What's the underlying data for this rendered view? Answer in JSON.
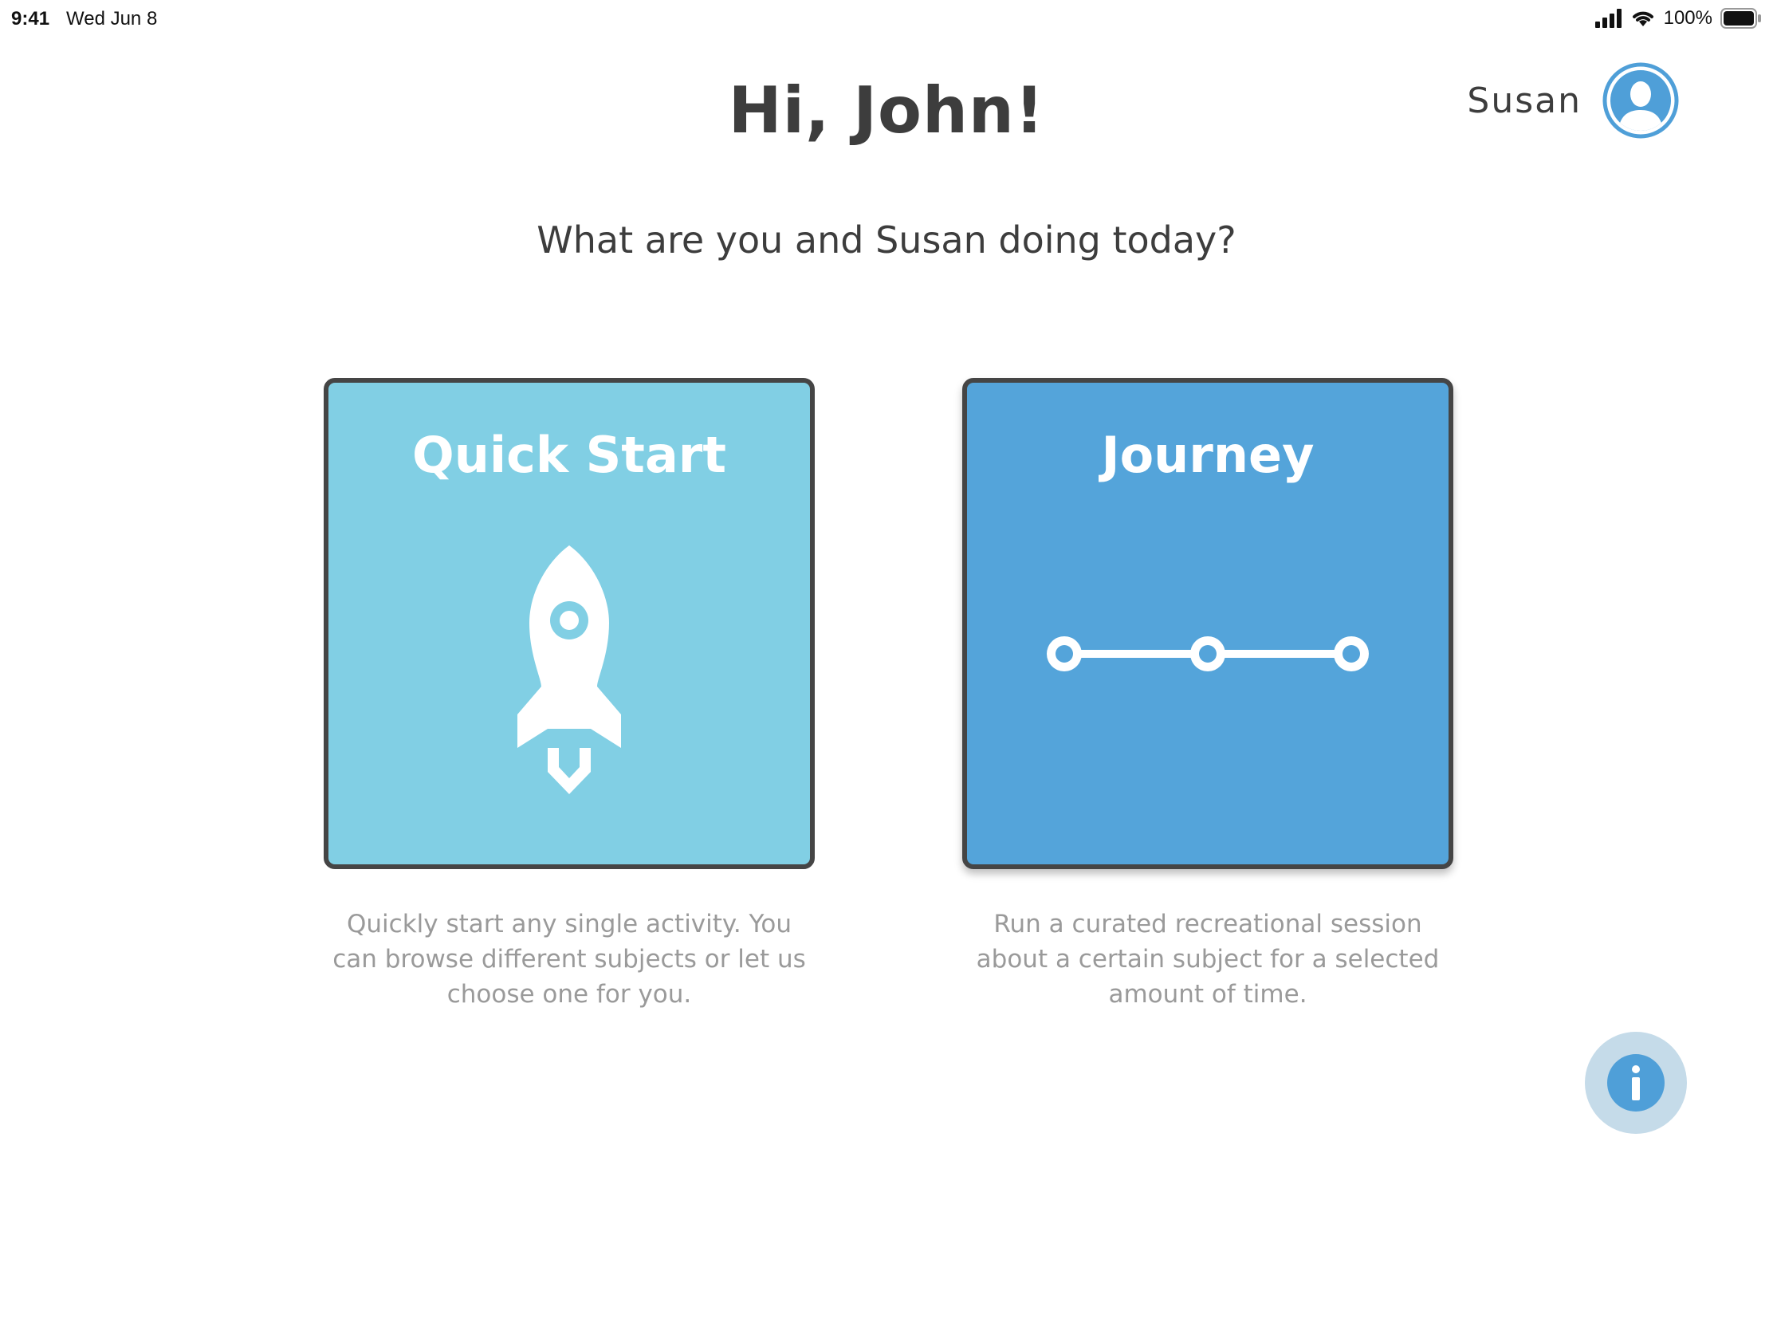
{
  "status_bar": {
    "time": "9:41",
    "date": "Wed Jun 8",
    "battery_percent": "100%",
    "icons": [
      "signal-icon",
      "wifi-icon",
      "battery-icon"
    ]
  },
  "header": {
    "greeting": "Hi, John!",
    "user_name": "Susan",
    "avatar_icon": "user-avatar-icon"
  },
  "prompt": "What are you and Susan doing today?",
  "cards": [
    {
      "id": "quick-start",
      "title": "Quick Start",
      "icon": "rocket-icon",
      "description": "Quickly start any single activity. You can browse different subjects or let us choose one for you.",
      "color": "#81cfe4"
    },
    {
      "id": "journey",
      "title": "Journey",
      "icon": "journey-path-icon",
      "description": "Run a curated recreational session about a certain subject for a selected amount of time.",
      "color": "#54a4da"
    }
  ],
  "info_button": {
    "icon": "info-icon",
    "color": "#4f9fd8"
  }
}
